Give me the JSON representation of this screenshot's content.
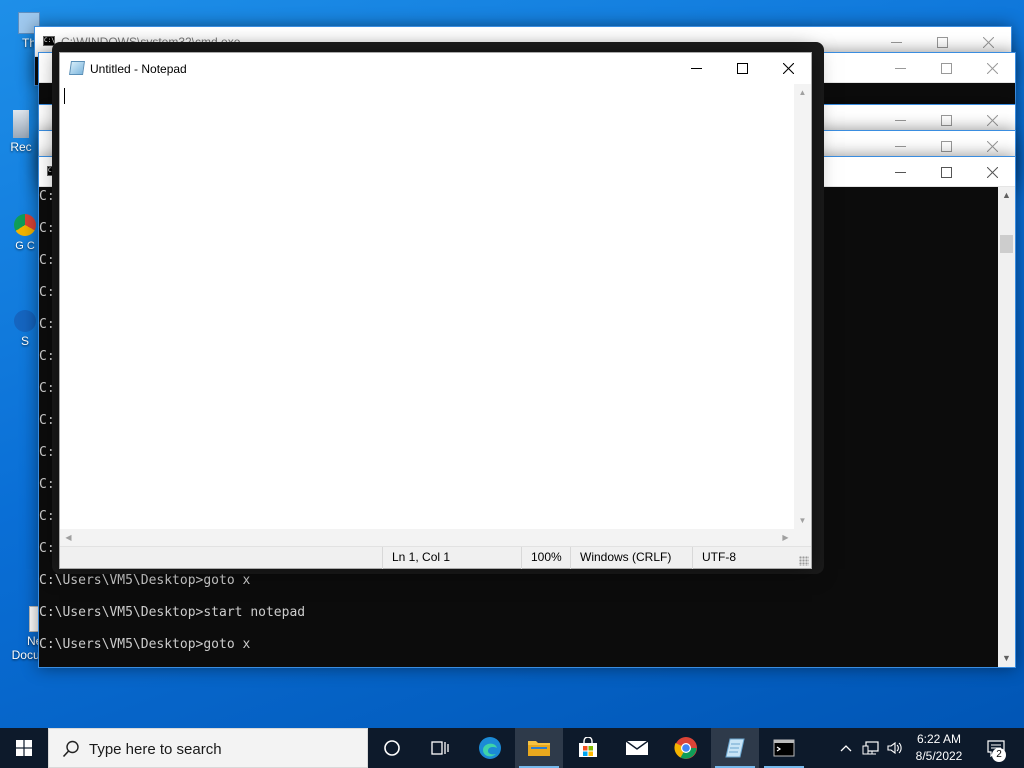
{
  "desktop": {
    "icons": [
      {
        "label": "Th"
      },
      {
        "label": "Rec"
      },
      {
        "label": "G C"
      },
      {
        "label": "S"
      },
      {
        "label": "New Document"
      }
    ]
  },
  "back_consoles": [
    {
      "title": "C:\\WINDOWS\\system32\\cmd.exe"
    }
  ],
  "main_console": {
    "prompt_lines": [
      "C:\\",
      "C:\\",
      "C:\\",
      "C:\\",
      "C:\\",
      "C:\\",
      "C:\\",
      "C:\\",
      "C:\\",
      "C:\\",
      "C:\\",
      "C:\\"
    ],
    "lines": [
      "C:\\Users\\VM5\\Desktop>goto x",
      "C:\\Users\\VM5\\Desktop>start notepad",
      "C:\\Users\\VM5\\Desktop>goto x"
    ]
  },
  "notepad": {
    "title": "Untitled - Notepad",
    "content": "",
    "status": {
      "position": "Ln 1, Col 1",
      "zoom": "100%",
      "line_ending": "Windows (CRLF)",
      "encoding": "UTF-8"
    }
  },
  "taskbar": {
    "search_placeholder": "Type here to search",
    "pinned": [
      "task-view-icon",
      "edge-icon",
      "file-explorer-icon",
      "store-icon",
      "mail-icon",
      "chrome-icon",
      "notepad-icon",
      "cmd-icon"
    ],
    "clock": {
      "time": "6:22 AM",
      "date": "8/5/2022"
    },
    "notification_count": "2"
  },
  "colors": {
    "desktop": "#0a6fd6",
    "taskbar": "#0d1a2b",
    "console_bg": "#0c0c0c",
    "console_text": "#cccccc",
    "accent": "#3a8de0"
  }
}
